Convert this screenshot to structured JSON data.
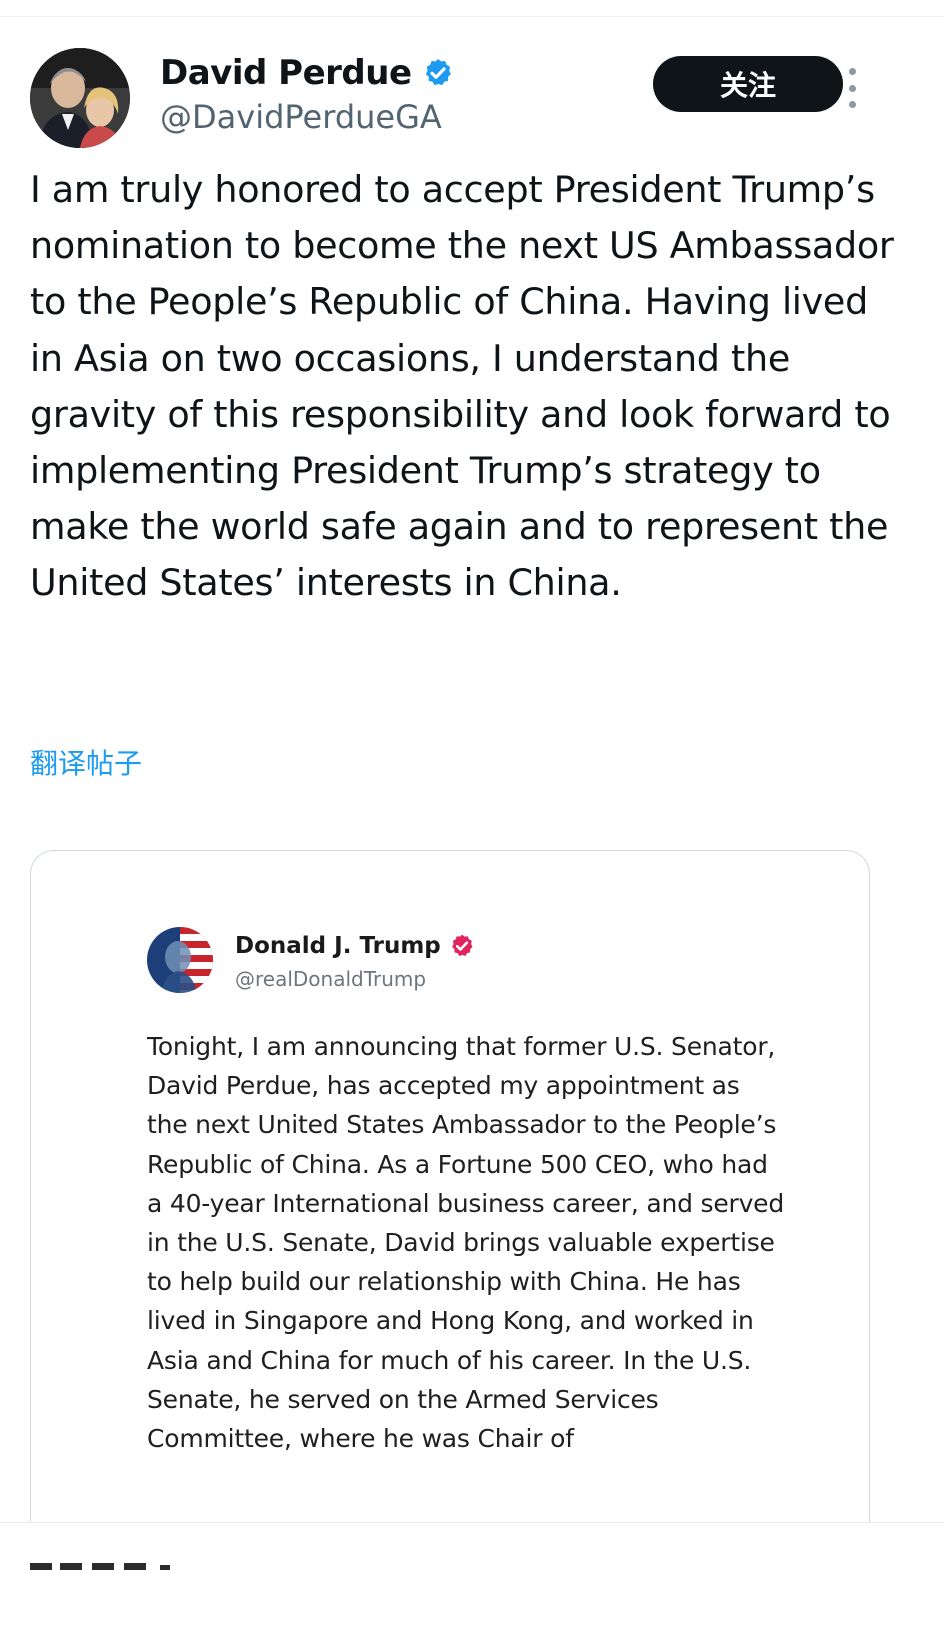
{
  "post": {
    "author": {
      "name": "David Perdue",
      "handle": "@DavidPerdueGA",
      "verified_color": "#1d9bf0"
    },
    "follow_label": "关注",
    "more_icon": "more-vertical-icon",
    "text": "I am truly honored to accept President Trump’s nomination to become the next US Ambassador to the People’s Republic of China. Having lived in Asia on two occasions, I understand the gravity of this responsibility and look forward to implementing President Trump’s strategy to make the world safe again and to represent the United States’ interests in China.",
    "translate_label": "翻译帖子"
  },
  "quote": {
    "author": {
      "name": "Donald J. Trump",
      "handle": "@realDonaldTrump",
      "verified_color": "#e0245e"
    },
    "text": "Tonight, I am announcing that former U.S. Senator, David Perdue, has accepted my appointment as the next United States Ambassador to the People’s Republic of China. As a Fortune 500 CEO, who had a 40-year International business career, and served in the U.S. Senate, David brings valuable expertise to help build our relationship with China. He has lived in Singapore and Hong Kong, and worked in Asia and China for much of his career. In the U.S. Senate, he served on the Armed Services Committee, where he was Chair of"
  },
  "colors": {
    "text_primary": "#0f1419",
    "text_secondary": "#536471",
    "link": "#1d9bf0",
    "follow_bg": "#0f1419",
    "follow_text": "#ffffff",
    "border": "#cfd9de"
  }
}
